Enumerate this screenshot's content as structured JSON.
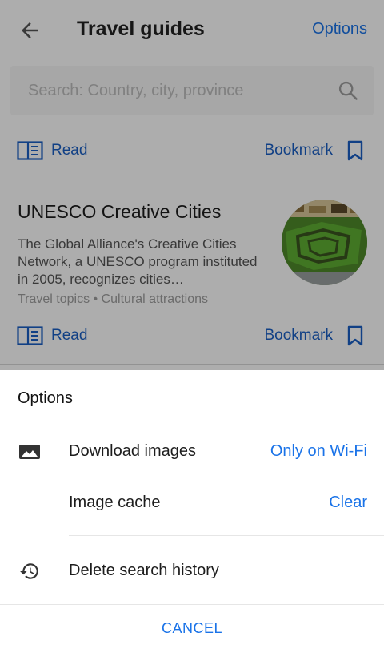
{
  "appbar": {
    "title": "Travel guides",
    "options_label": "Options"
  },
  "search": {
    "placeholder": "Search: Country, city, province"
  },
  "top_actions": {
    "read_label": "Read",
    "bookmark_label": "Bookmark"
  },
  "card": {
    "title": "UNESCO Creative Cities",
    "description": "The Global Alliance's Creative Cities Network, a UNESCO program instituted in 2005, recognizes cities…",
    "meta": "Travel topics • Cultural attractions",
    "read_label": "Read",
    "bookmark_label": "Bookmark"
  },
  "sheet": {
    "title": "Options",
    "rows": [
      {
        "label": "Download images",
        "value": "Only on Wi-Fi",
        "icon": "image-icon"
      },
      {
        "label": "Image cache",
        "value": "Clear",
        "icon": ""
      },
      {
        "label": "Delete search history",
        "value": "",
        "icon": "history-icon"
      }
    ],
    "cancel_label": "CANCEL"
  },
  "colors": {
    "accent": "#1a73e8",
    "link_dark": "#1a5fc4",
    "scrim": "rgba(0,0,0,0.32)"
  }
}
